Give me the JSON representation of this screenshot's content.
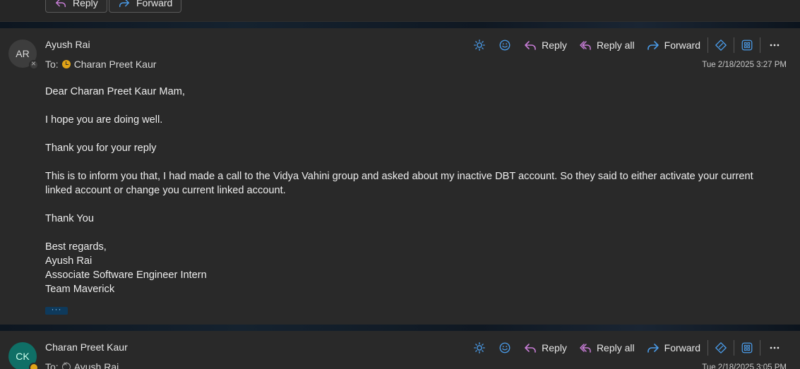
{
  "previous_message": {
    "reply_label": "Reply",
    "forward_label": "Forward"
  },
  "message1": {
    "avatar_initials": "AR",
    "sender": "Ayush Rai",
    "to_label": "To:",
    "recipient": "Charan Preet Kaur",
    "date": "Tue 2/18/2025 3:27 PM",
    "actions": {
      "reply": "Reply",
      "reply_all": "Reply all",
      "forward": "Forward"
    },
    "body": [
      "Dear Charan Preet Kaur Mam,",
      "",
      "I hope you are doing well.",
      "",
      "Thank you for your reply",
      "",
      "This is to inform you that, I had made a call to the Vidya Vahini group and asked about my inactive DBT account. So they said to either activate your current linked account or change you current linked account.",
      "",
      "Thank You",
      "",
      "Best regards,",
      "Ayush Rai",
      "Associate Software Engineer Intern",
      "Team Maverick"
    ],
    "show_more": "···"
  },
  "message2": {
    "avatar_initials": "CK",
    "sender": "Charan Preet Kaur",
    "to_label": "To:",
    "recipient": "Ayush Rai",
    "date": "Tue 2/18/2025 3:05 PM",
    "actions": {
      "reply": "Reply",
      "reply_all": "Reply all",
      "forward": "Forward"
    }
  },
  "colors": {
    "background": "#1f1f1f",
    "card": "#292929",
    "accent_blue": "#4a9be8",
    "reply_purple": "#c77dd6",
    "away_yellow": "#e0a317",
    "teal_avatar": "#0f6f66"
  },
  "icons": [
    "reply-arrow-icon",
    "forward-arrow-icon",
    "brightness-icon",
    "emoji-icon",
    "reply-all-icon",
    "immersive-reader-icon",
    "apps-icon",
    "more-icon"
  ]
}
